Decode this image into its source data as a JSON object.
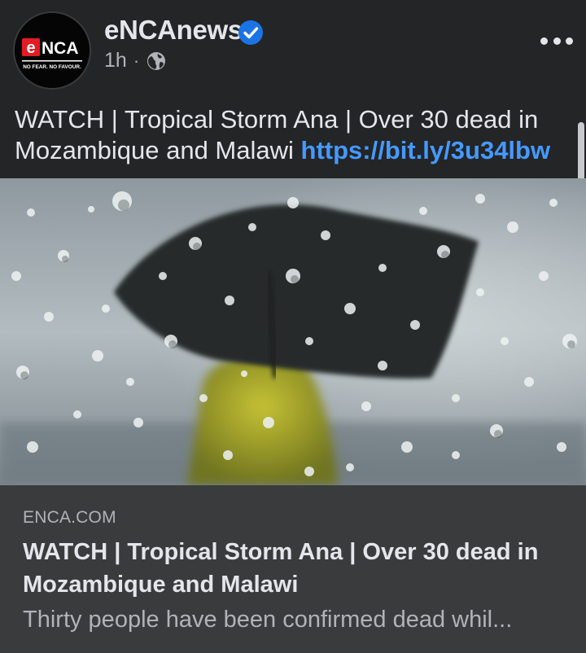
{
  "header": {
    "page_name": "eNCAnews",
    "time": "1h",
    "separator": "·",
    "avatar": {
      "logo_text": "eNCA",
      "tagline": "NO FEAR. NO FAVOUR."
    }
  },
  "icons": {
    "verified": "verified-badge-icon",
    "audience": "globe-icon",
    "more": "more-options-icon"
  },
  "post": {
    "text": "WATCH | Tropical Storm Ana | Over 30 dead in Mozambique and Malawi ",
    "link": "https://bit.ly/3u34lbw"
  },
  "link_preview": {
    "domain": "ENCA.COM",
    "title": "WATCH | Tropical Storm Ana | Over 30 dead in Mozambique and Malawi",
    "description": "Thirty people have been confirmed dead whil..."
  },
  "colors": {
    "background": "#242526",
    "preview_background": "#3a3b3c",
    "primary_text": "#e4e6eb",
    "secondary_text": "#b0b3b8",
    "link": "#4599ff",
    "verified_blue": "#1b74e4",
    "logo_red": "#e31b23"
  }
}
